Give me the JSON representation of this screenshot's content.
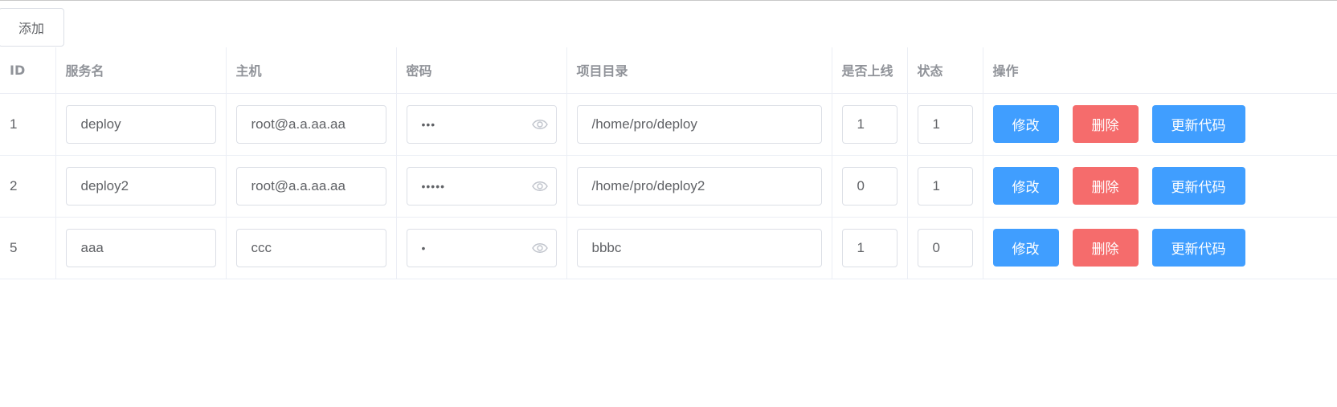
{
  "toolbar": {
    "add_label": "添加"
  },
  "table": {
    "headers": {
      "id": "ID",
      "service": "服务名",
      "host": "主机",
      "password": "密码",
      "dir": "项目目录",
      "online": "是否上线",
      "status": "状态",
      "actions": "操作"
    },
    "rows": [
      {
        "id": "1",
        "service": "deploy",
        "host": "root@a.a.aa.aa",
        "password_mask": "•••",
        "dir": "/home/pro/deploy",
        "online": "1",
        "status": "1"
      },
      {
        "id": "2",
        "service": "deploy2",
        "host": "root@a.a.aa.aa",
        "password_mask": "•••••",
        "dir": "/home/pro/deploy2",
        "online": "0",
        "status": "1"
      },
      {
        "id": "5",
        "service": "aaa",
        "host": "ccc",
        "password_mask": "•",
        "dir": "bbbc",
        "online": "1",
        "status": "0"
      }
    ],
    "actions": {
      "edit": "修改",
      "delete": "删除",
      "update": "更新代码"
    }
  },
  "colors": {
    "primary": "#409eff",
    "danger": "#f56c6c",
    "border": "#dcdfe6"
  },
  "icons": {
    "password_toggle": "eye-icon"
  }
}
